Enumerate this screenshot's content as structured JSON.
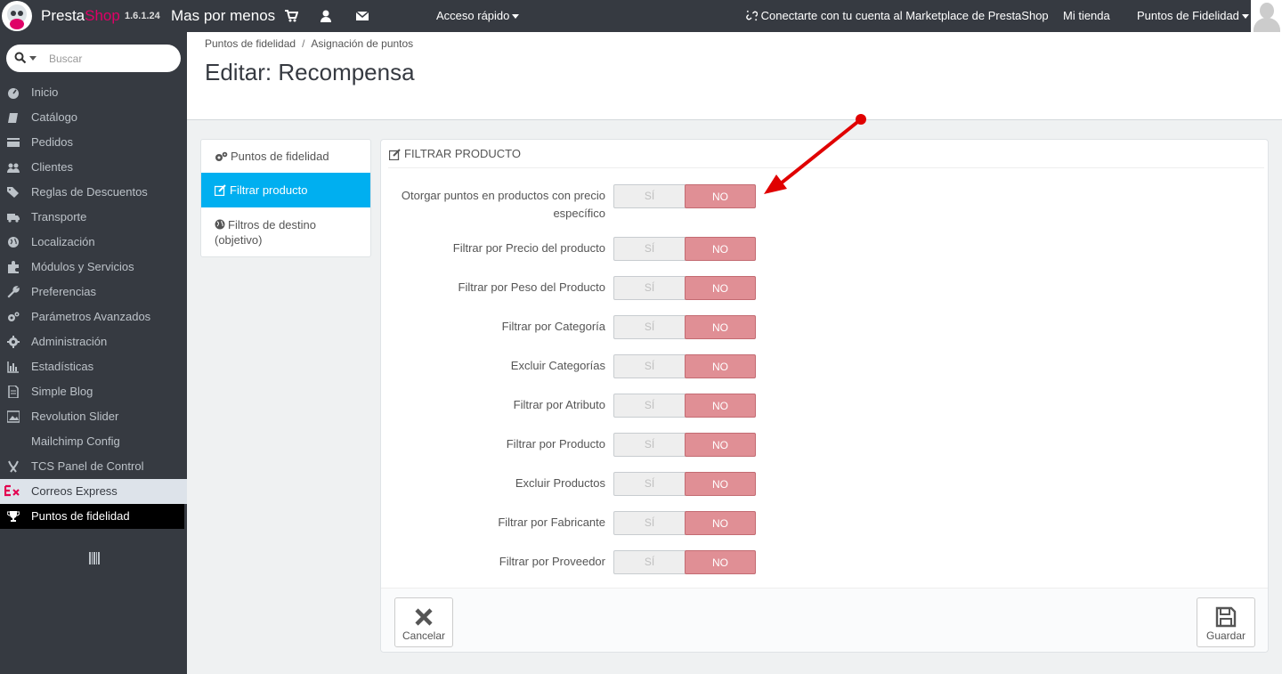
{
  "topbar": {
    "brand_presta": "Presta",
    "brand_shop": "Shop",
    "version": "1.6.1.24",
    "shop_name": "Mas por menos",
    "quick_access": "Acceso rápido",
    "marketplace": "Conectarte con tu cuenta al Marketplace de PrestaShop",
    "my_store": "Mi tienda",
    "loyalty_menu": "Puntos de Fidelidad"
  },
  "sidebar": {
    "search_placeholder": "Buscar",
    "items": [
      {
        "label": "Inicio",
        "icon": "dashboard-icon"
      },
      {
        "label": "Catálogo",
        "icon": "book-icon"
      },
      {
        "label": "Pedidos",
        "icon": "credit-card-icon"
      },
      {
        "label": "Clientes",
        "icon": "users-icon"
      },
      {
        "label": "Reglas de Descuentos",
        "icon": "tags-icon"
      },
      {
        "label": "Transporte",
        "icon": "truck-icon"
      },
      {
        "label": "Localización",
        "icon": "globe-icon"
      },
      {
        "label": "Módulos y Servicios",
        "icon": "puzzle-icon"
      },
      {
        "label": "Preferencias",
        "icon": "wrench-icon"
      },
      {
        "label": "Parámetros Avanzados",
        "icon": "cogs-icon"
      },
      {
        "label": "Administración",
        "icon": "cog-icon"
      },
      {
        "label": "Estadísticas",
        "icon": "bar-chart-icon"
      },
      {
        "label": "Simple Blog",
        "icon": "file-icon"
      },
      {
        "label": "Revolution Slider",
        "icon": "picture-icon"
      },
      {
        "label": "Mailchimp Config",
        "icon": ""
      },
      {
        "label": "TCS Panel de Control",
        "icon": "tools-icon"
      },
      {
        "label": "Correos Express",
        "icon": "correos-express-logo"
      },
      {
        "label": "Puntos de fidelidad",
        "icon": "trophy-icon"
      }
    ]
  },
  "header": {
    "breadcrumb": [
      "Puntos de fidelidad",
      "Asignación de puntos"
    ],
    "title": "Editar: Recompensa"
  },
  "tabs": [
    {
      "label": "Puntos de fidelidad",
      "icon": "cogs-icon"
    },
    {
      "label": "Filtrar producto",
      "icon": "edit-icon"
    },
    {
      "label": "Filtros de destino (objetivo)",
      "icon": "globe-icon"
    }
  ],
  "panel": {
    "title": "Filtrar producto",
    "yes_label": "SÍ",
    "no_label": "NO",
    "rows": [
      {
        "label": "Otorgar puntos en productos con precio específico",
        "value": "NO"
      },
      {
        "label": "Filtrar por Precio del producto",
        "value": "NO"
      },
      {
        "label": "Filtrar por Peso del Producto",
        "value": "NO"
      },
      {
        "label": "Filtrar por Categoría",
        "value": "NO"
      },
      {
        "label": "Excluir Categorías",
        "value": "NO"
      },
      {
        "label": "Filtrar por Atributo",
        "value": "NO"
      },
      {
        "label": "Filtrar por Producto",
        "value": "NO"
      },
      {
        "label": "Excluir Productos",
        "value": "NO"
      },
      {
        "label": "Filtrar por Fabricante",
        "value": "NO"
      },
      {
        "label": "Filtrar por Proveedor",
        "value": "NO"
      }
    ],
    "cancel_label": "Cancelar",
    "save_label": "Guardar"
  },
  "colors": {
    "topbar": "#363a41",
    "brand_pink": "#df0067",
    "active_tab": "#00aff0",
    "switch_no": "#e08f95",
    "annotation_arrow": "#e00000"
  }
}
